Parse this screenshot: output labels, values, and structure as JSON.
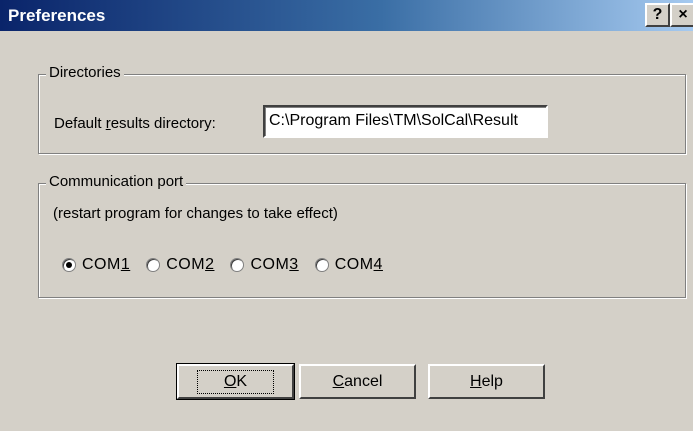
{
  "window": {
    "title": "Preferences",
    "help_button": "?",
    "close_button": "×"
  },
  "directories": {
    "group_label": "Directories",
    "field_label_prefix": "Default ",
    "field_label_accel": "r",
    "field_label_suffix": "esults directory:",
    "value": "C:\\Program Files\\TM\\SolCal\\Result"
  },
  "comm_port": {
    "group_label": "Communication port",
    "note": "(restart program for changes to take effect)",
    "selected": "COM1",
    "options": [
      {
        "prefix": "COM",
        "accel": "1"
      },
      {
        "prefix": "COM",
        "accel": "2"
      },
      {
        "prefix": "COM",
        "accel": "3"
      },
      {
        "prefix": "COM",
        "accel": "4"
      }
    ]
  },
  "buttons": {
    "ok": {
      "accel": "O",
      "rest": "K"
    },
    "cancel": {
      "accel": "C",
      "rest": "ancel"
    },
    "help": {
      "accel": "H",
      "rest": "elp"
    }
  }
}
